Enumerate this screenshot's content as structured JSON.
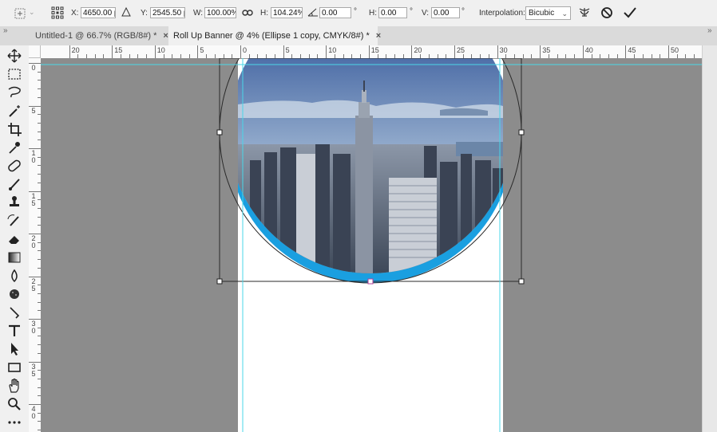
{
  "options_bar": {
    "x_label": "X:",
    "x_value": "4650.00 px",
    "y_label": "Y:",
    "y_value": "2545.50 px",
    "w_label": "W:",
    "w_value": "100.00%",
    "h_label": "H:",
    "h_value": "104.24%",
    "angle_value": "0.00",
    "angle_unit": "°",
    "skew_h_label": "H:",
    "skew_h_value": "0.00",
    "skew_h_unit": "°",
    "skew_v_label": "V:",
    "skew_v_value": "0.00",
    "skew_v_unit": "°",
    "interpolation_label": "Interpolation:",
    "interpolation_value": "Bicubic"
  },
  "tabs": [
    {
      "label": "Untitled-1 @ 66.7% (RGB/8#) *",
      "close": "×",
      "active": false
    },
    {
      "label": "Roll Up Banner @ 4% (Ellipse 1 copy, CMYK/8#) *",
      "close": "×",
      "active": true
    }
  ],
  "rulers": {
    "horizontal": [
      "20",
      "15",
      "10",
      "5",
      "0",
      "5",
      "10",
      "15",
      "20",
      "25",
      "30",
      "35",
      "40",
      "45",
      "50"
    ],
    "vertical": [
      "0",
      "5",
      "1\n0",
      "1\n5",
      "2\n0",
      "2\n5",
      "3\n0",
      "3\n5",
      "4\n0"
    ]
  },
  "panel_collapse": "»",
  "toolbar_collapse": "»",
  "colors": {
    "canvas_bg": "#8c8c8c",
    "document": "#ffffff",
    "guide": "#4ad7e8",
    "ellipse_blue": "#1a9fe0"
  },
  "tools": [
    "move-tool-icon",
    "marquee-tool-icon",
    "lasso-tool-icon",
    "magic-wand-icon",
    "crop-tool-icon",
    "eyedropper-icon",
    "healing-brush-icon",
    "brush-icon",
    "stamp-icon",
    "history-brush-icon",
    "eraser-icon",
    "gradient-icon",
    "blur-icon",
    "sponge-icon",
    "pen-icon",
    "type-icon",
    "path-select-icon",
    "rectangle-icon",
    "hand-icon",
    "zoom-icon",
    "more-tools-icon"
  ]
}
